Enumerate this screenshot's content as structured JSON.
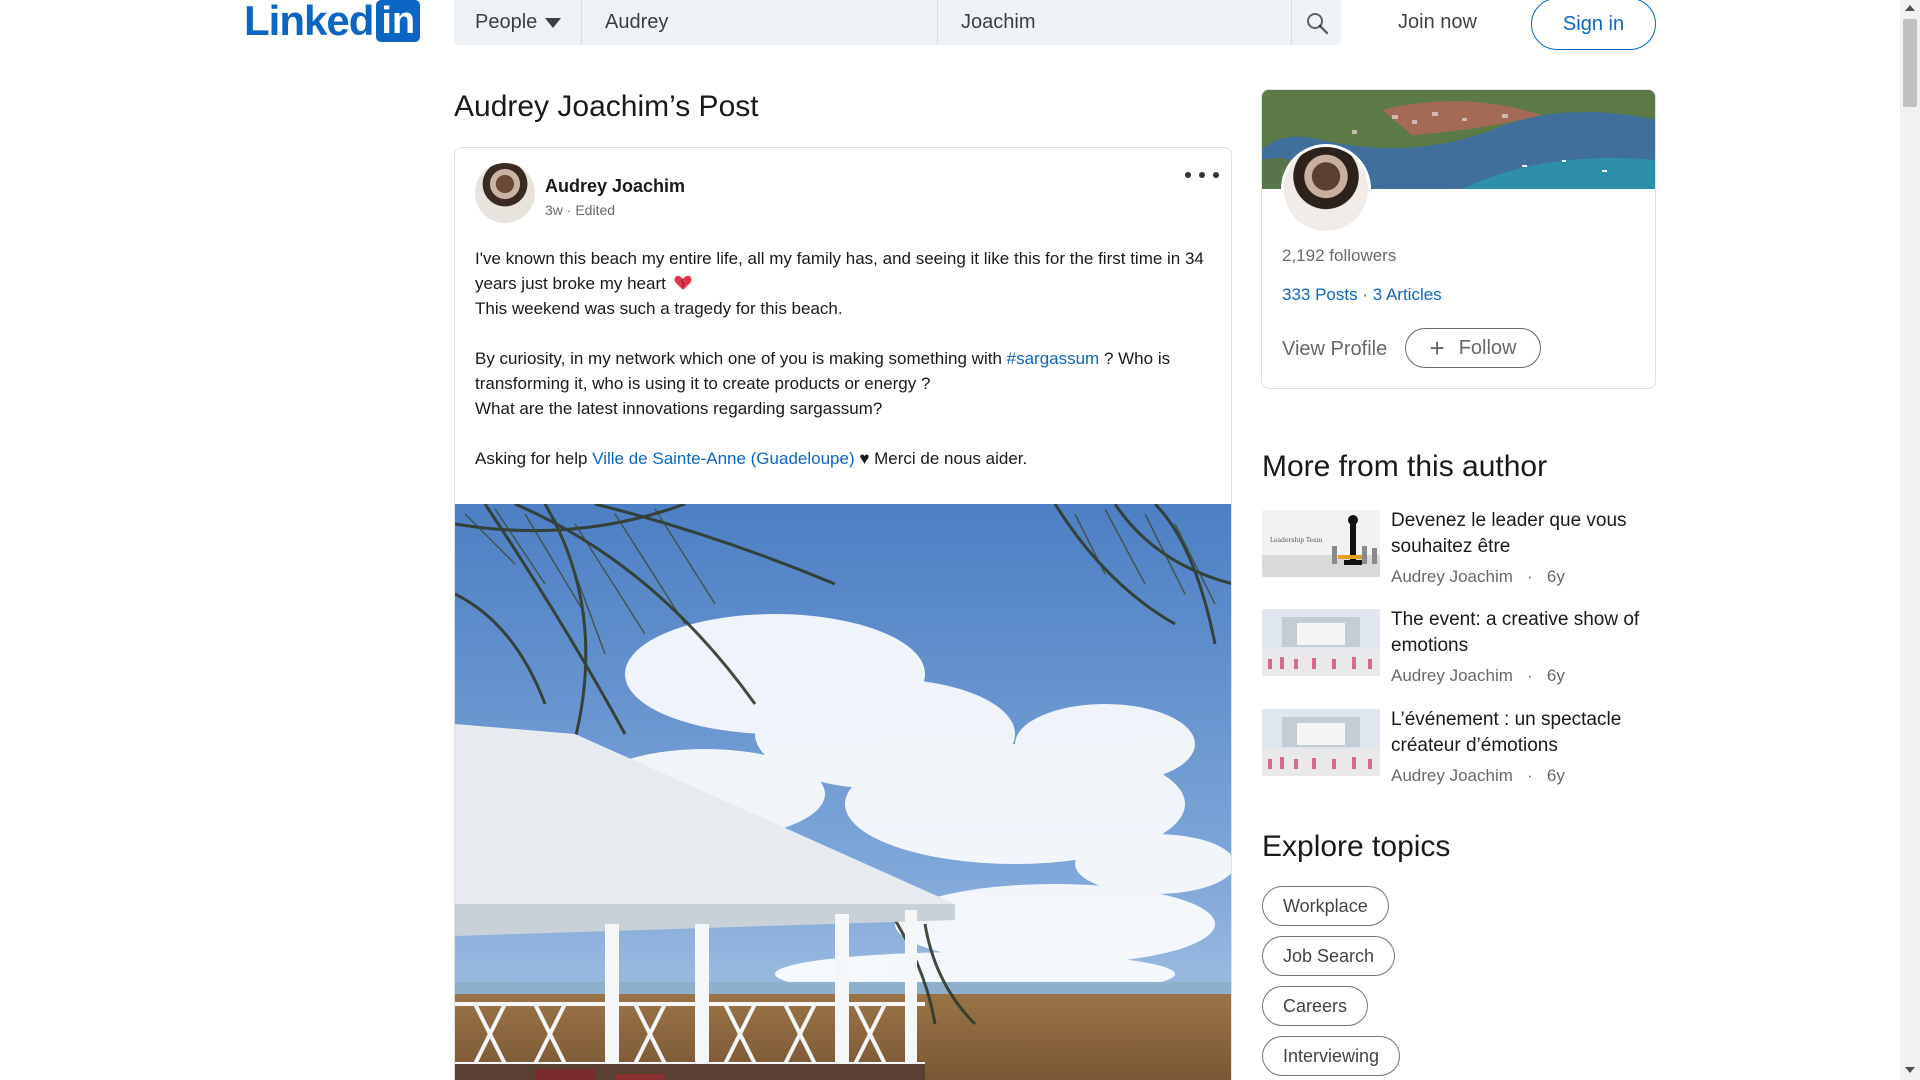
{
  "header": {
    "logo_text": "Linked",
    "logo_box": "in",
    "search_select_label": "People",
    "first_name_value": "Audrey",
    "last_name_value": "Joachim",
    "join_now_label": "Join now",
    "sign_in_label": "Sign in"
  },
  "page": {
    "title": "Audrey Joachim’s Post"
  },
  "post": {
    "author": "Audrey Joachim",
    "meta": "3w · Edited",
    "line1": "I've known this beach my entire life, all my family has, and seeing it like this for the first time in 34 years just broke my heart",
    "line2": "This weekend was such a tragedy for this beach.",
    "line3_prefix": "By curiosity, in my network which one of you is making something with ",
    "hashtag": "#sargassum",
    "line3_suffix": " ? Who is transforming it, who is using it to create products or energy ?",
    "line4": "What are the latest innovations regarding sargassum?",
    "line5_prefix": "Asking for help ",
    "mention": "Ville de Sainte-Anne (Guadeloupe)",
    "line5_suffix": " ♥ Merci de nous aider."
  },
  "profile_card": {
    "followers": "2,192 followers",
    "posts_articles": "333 Posts · 3 Articles",
    "view_profile": "View Profile",
    "follow_label": "Follow"
  },
  "more_from_author": {
    "title": "More from this author",
    "articles": [
      {
        "title": "Devenez le leader que vous souhaitez être",
        "author": "Audrey Joachim",
        "age": "6y"
      },
      {
        "title": "The event: a creative show of emotions",
        "author": "Audrey Joachim",
        "age": "6y"
      },
      {
        "title": "L’événement : un spectacle créateur d’émotions",
        "author": "Audrey Joachim",
        "age": "6y"
      }
    ]
  },
  "explore_topics": {
    "title": "Explore topics",
    "topics": [
      "Workplace",
      "Job Search",
      "Careers",
      "Interviewing"
    ]
  },
  "colors": {
    "brand": "#0a66c2",
    "search_bg": "#eef3f8",
    "heart": "#e0334e"
  },
  "icons": [
    "search-icon",
    "caret-down-icon",
    "more-icon",
    "heart-icon",
    "plus-icon"
  ]
}
